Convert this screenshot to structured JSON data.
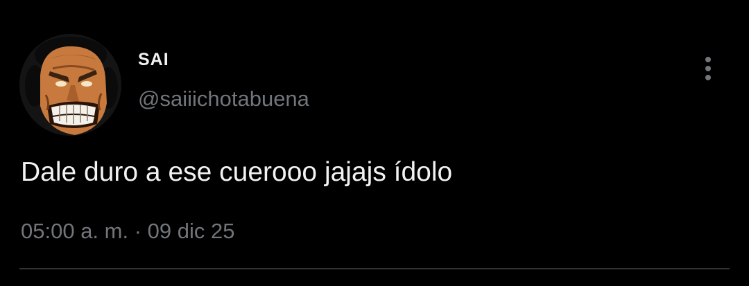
{
  "tweet": {
    "author": {
      "display_name": "SAI",
      "handle": "@saiiichotabuena",
      "avatar_icon": "angry-character-face-icon"
    },
    "text": "Dale duro a ese cuerooo jajajs ídolo",
    "time": "05:00 a. m.",
    "separator": "·",
    "date": "09 dic 25",
    "more_icon": "vertical-ellipsis-icon"
  },
  "colors": {
    "background": "#000000",
    "primary_text": "#f2f2f2",
    "secondary_text": "#71767b",
    "divider": "#2f3336"
  }
}
